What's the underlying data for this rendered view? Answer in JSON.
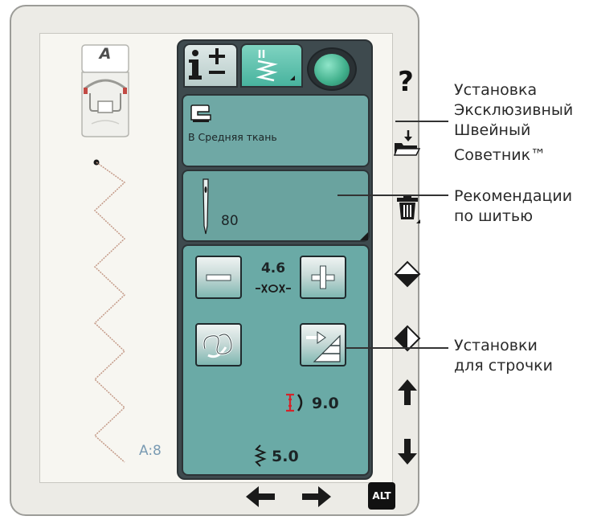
{
  "presser_foot": {
    "label": "A"
  },
  "stitch": {
    "id": "A:8"
  },
  "tabs": {
    "info_label": "i±"
  },
  "fabric": {
    "label": "B Средняя ткань"
  },
  "needle": {
    "size": "80"
  },
  "settings": {
    "width_value": "4.6",
    "length_value": "9.0",
    "zigzag_value": "5.0"
  },
  "side_buttons": {
    "help_label": "?",
    "alt_label": "ALT"
  },
  "callouts": [
    {
      "lines": [
        "Установка",
        "Эксклюзивный",
        "Швейный",
        "Советник™"
      ]
    },
    {
      "lines": [
        "Рекомендации",
        "по шитью"
      ]
    },
    {
      "lines": [
        "Установки",
        "для строчки"
      ]
    }
  ],
  "icons": {
    "help": "question-mark",
    "import": "folder-download",
    "delete": "trash",
    "mirror_horizontal": "diamond-half-horizontal",
    "mirror_vertical": "diamond-half-vertical",
    "up": "arrow-up",
    "down": "arrow-down",
    "left": "arrow-left",
    "right": "arrow-right"
  },
  "colors": {
    "panel_teal": "#6fa8a5",
    "stitch_tab_active": "#48b39e",
    "stitch_line": "#c49a88",
    "length_icon": "#d4242a"
  }
}
